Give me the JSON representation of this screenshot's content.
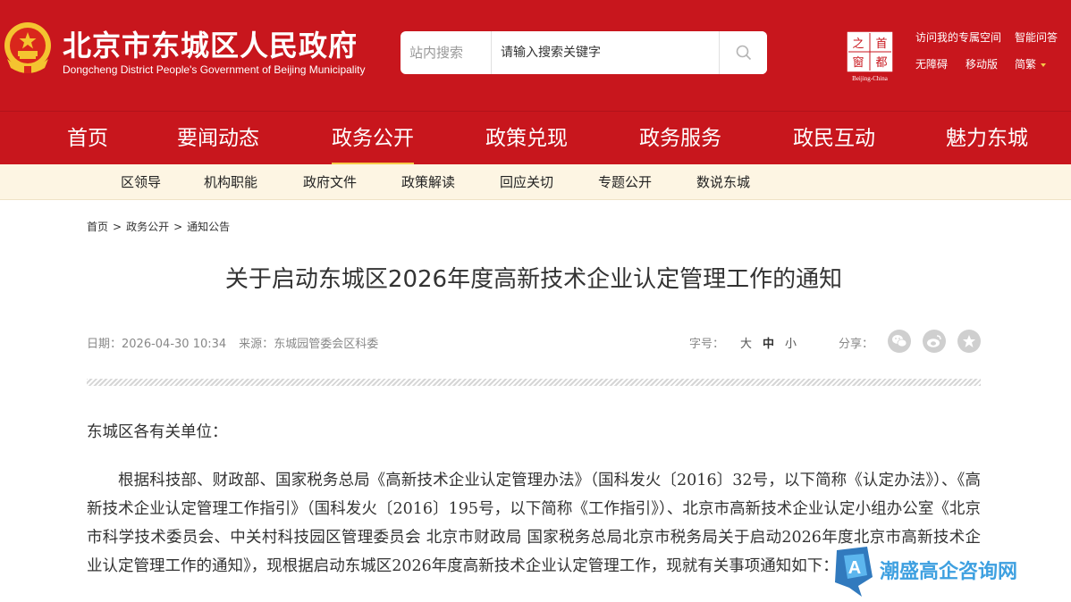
{
  "header": {
    "site_name": "北京市东城区人民政府",
    "site_name_en": "Dongcheng District People's Government of Beijing Municipality",
    "search": {
      "scope": "站内搜索",
      "placeholder": "请输入搜索关键字"
    },
    "logo": {
      "chars": [
        "之",
        "首",
        "窗",
        "都"
      ],
      "caption": "Beijing-China"
    },
    "links_row1": [
      "访问我的专属空间",
      "智能问答"
    ],
    "links_row2": [
      "无障碍",
      "移动版",
      "简繁"
    ]
  },
  "main_nav": {
    "items": [
      "首页",
      "要闻动态",
      "政务公开",
      "政策兑现",
      "政务服务",
      "政民互动",
      "魅力东城"
    ],
    "active": "政务公开"
  },
  "sub_nav": {
    "items": [
      "区领导",
      "机构职能",
      "政府文件",
      "政策解读",
      "回应关切",
      "专题公开",
      "数说东城"
    ]
  },
  "breadcrumb": [
    "首页",
    "政务公开",
    "通知公告"
  ],
  "breadcrumb_sep": ">",
  "article": {
    "title": "关于启动东城区2026年度高新技术企业认定管理工作的通知",
    "date_label": "日期：",
    "date": "2026-04-30 10:34",
    "source_label": "来源：",
    "source": "东城园管委会区科委",
    "font_size_label": "字号：",
    "font_sizes": [
      "大",
      "中",
      "小"
    ],
    "font_size_selected": "中",
    "share_label": "分享：",
    "salutation": "东城区各有关单位：",
    "paragraph1": "根据科技部、财政部、国家税务总局《高新技术企业认定管理办法》（国科发火〔2016〕32号，以下简称《认定办法》）、《高新技术企业认定管理工作指引》（国科发火〔2016〕195号，以下简称《工作指引》）、北京市高新技术企业认定小组办公室《北京市科学技术委员会、中关村科技园区管理委员会 北京市财政局 国家税务总局北京市税务局关于启动2026年度北京市高新技术企业认定管理工作的通知》，现根据启动东城区2026年度高新技术企业认定管理工作，现就有关事项通知如下："
  },
  "watermark": {
    "text": "潮盛高企咨询网"
  },
  "colors": {
    "brand_red": "#c8161d",
    "accent_gold": "#f7c948",
    "subnav_bg": "#fdf5e3",
    "watermark_blue": "#3ea0e0"
  },
  "icons": {
    "emblem": "national-emblem-icon",
    "search": "search-icon",
    "share": [
      "wechat-icon",
      "weibo-icon",
      "favorite-star-icon"
    ]
  }
}
